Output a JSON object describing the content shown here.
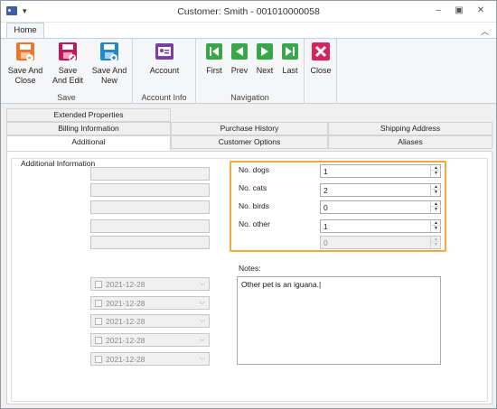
{
  "window": {
    "title": "Customer: Smith - 001010000058"
  },
  "ribbon": {
    "tab": "Home",
    "groups": [
      {
        "label": "Save",
        "buttons": [
          {
            "line1": "Save And",
            "line2": "Close",
            "icon": "save-close-icon",
            "color": "#e8762c"
          },
          {
            "line1": "Save",
            "line2": "And Edit",
            "icon": "save-edit-icon",
            "color": "#c2185b"
          },
          {
            "line1": "Save And",
            "line2": "New",
            "icon": "save-new-icon",
            "color": "#1e88c8"
          }
        ]
      },
      {
        "label": "Account Info",
        "buttons": [
          {
            "line1": "Account",
            "line2": "",
            "icon": "account-card-icon",
            "color": "#7a3fa0"
          }
        ]
      },
      {
        "label": "Navigation",
        "buttons": [
          {
            "line1": "First",
            "line2": "",
            "icon": "first-icon",
            "color": "#3aa64a"
          },
          {
            "line1": "Prev",
            "line2": "",
            "icon": "prev-icon",
            "color": "#3aa64a"
          },
          {
            "line1": "Next",
            "line2": "",
            "icon": "next-icon",
            "color": "#3aa64a"
          },
          {
            "line1": "Last",
            "line2": "",
            "icon": "last-icon",
            "color": "#3aa64a"
          }
        ]
      },
      {
        "label": "",
        "buttons": [
          {
            "line1": "Close",
            "line2": "",
            "icon": "close-x-icon",
            "color": "#d6245e"
          }
        ]
      }
    ]
  },
  "tabs": {
    "row1": [
      "Extended Properties"
    ],
    "row2": [
      "Billing Information",
      "Purchase History",
      "Shipping Address"
    ],
    "row3": [
      "Additional",
      "Customer Options",
      "Aliases"
    ],
    "active": "Additional"
  },
  "additional": {
    "group_caption": "Additional Information",
    "dates": [
      "2021-12-28",
      "2021-12-28",
      "2021-12-28",
      "2021-12-28",
      "2021-12-28"
    ],
    "counts": [
      {
        "label": "No. dogs",
        "value": "1"
      },
      {
        "label": "No. cats",
        "value": "2"
      },
      {
        "label": "No. birds",
        "value": "0"
      },
      {
        "label": "No. other",
        "value": "1"
      },
      {
        "label": "",
        "value": "0"
      }
    ],
    "notes_label": "Notes:",
    "notes_value": "Other pet is an iguana."
  },
  "colors": {
    "highlight": "#f2a93b",
    "accent": "#3c5ea8"
  }
}
